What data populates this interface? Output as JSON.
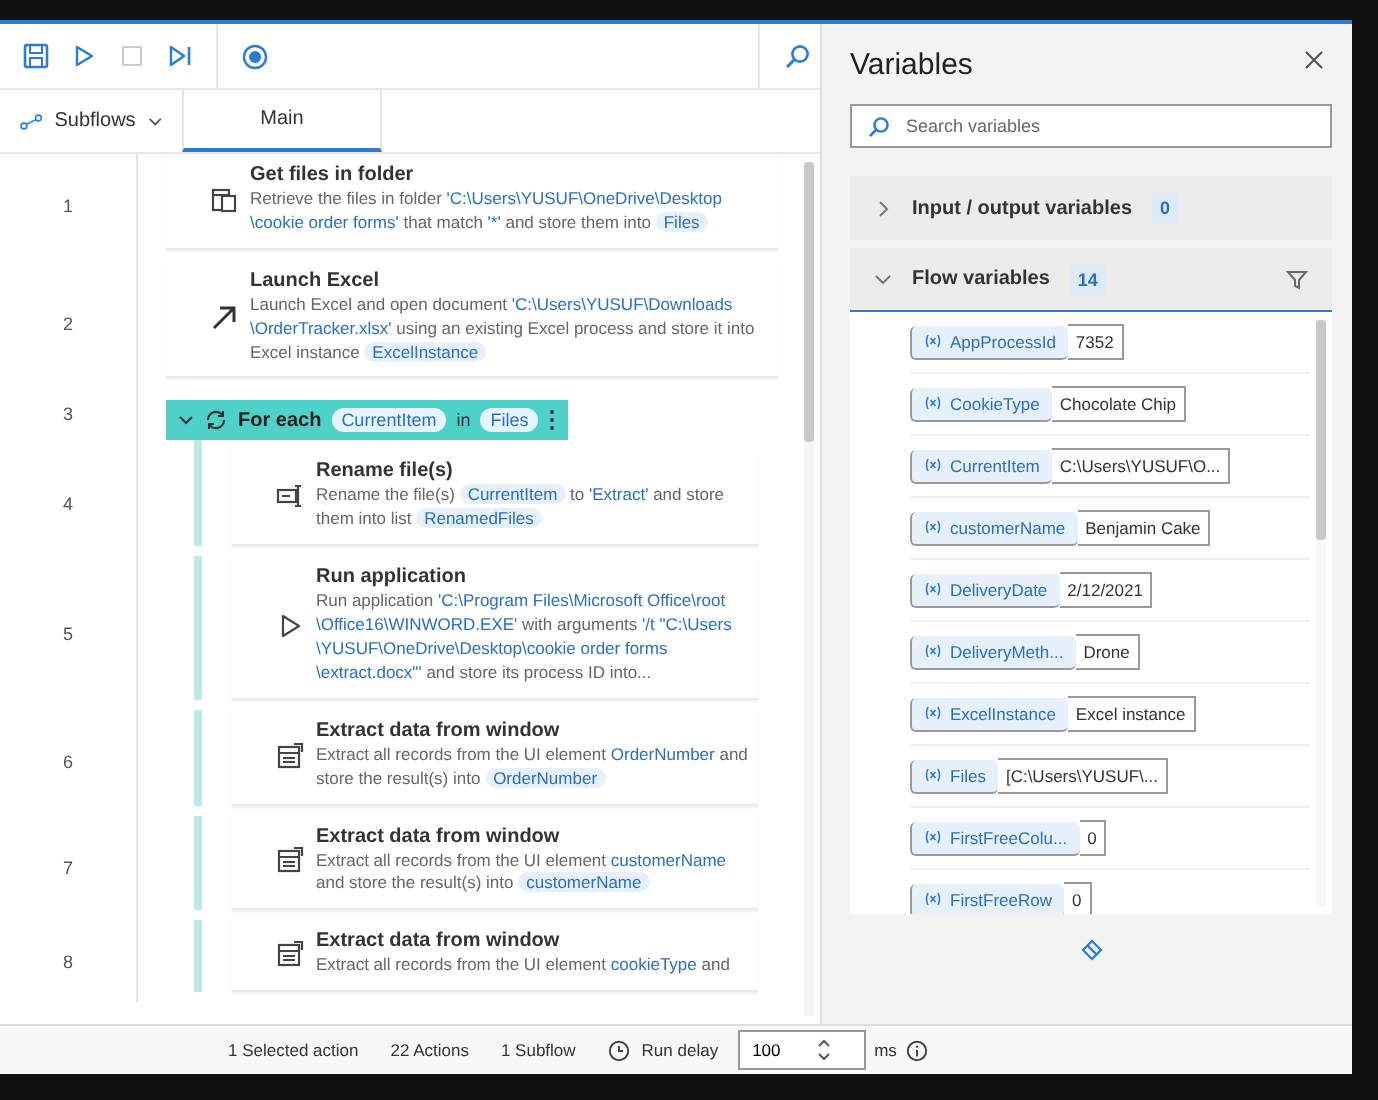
{
  "subflows_button": {
    "label": "Subflows"
  },
  "tabs": [
    {
      "label": "Main",
      "selected": true
    }
  ],
  "actions": [
    {
      "number": "1",
      "kind": "files",
      "selected": false,
      "title": "Get files in folder",
      "description": [
        {
          "kind": "text",
          "text": "Retrieve the files in folder "
        },
        {
          "kind": "literal",
          "text": "'C:\\Users\\YUSUF\\OneDrive\\Desktop \\cookie order forms'"
        },
        {
          "kind": "text",
          "text": " that match "
        },
        {
          "kind": "literal",
          "text": "'*'"
        },
        {
          "kind": "text",
          "text": " and store them into "
        },
        {
          "kind": "variable",
          "text": "Files"
        }
      ]
    },
    {
      "number": "2",
      "kind": "launch",
      "selected": false,
      "title": "Launch Excel",
      "description": [
        {
          "kind": "text",
          "text": "Launch Excel and open document "
        },
        {
          "kind": "literal",
          "text": "'C:\\Users\\YUSUF\\Downloads \\OrderTracker.xlsx'"
        },
        {
          "kind": "text",
          "text": " using an existing Excel process and store it into Excel instance "
        },
        {
          "kind": "variable",
          "text": "ExcelInstance"
        }
      ]
    },
    {
      "number": "3",
      "kind": "loop",
      "selected": true,
      "expanded": true,
      "header": [
        {
          "kind": "text",
          "text": "For each"
        },
        {
          "kind": "variable",
          "text": "CurrentItem"
        },
        {
          "kind": "text",
          "text": "in"
        },
        {
          "kind": "variable",
          "text": "Files"
        }
      ],
      "children": [
        {
          "number": "4",
          "kind": "rename",
          "selected": false,
          "title": "Rename file(s)",
          "description": [
            {
              "kind": "text",
              "text": "Rename the file(s) "
            },
            {
              "kind": "variable",
              "text": "CurrentItem"
            },
            {
              "kind": "text",
              "text": " to "
            },
            {
              "kind": "literal",
              "text": "'Extract'"
            },
            {
              "kind": "text",
              "text": " and store them into list "
            },
            {
              "kind": "variable",
              "text": "RenamedFiles"
            }
          ]
        },
        {
          "number": "5",
          "kind": "run",
          "selected": false,
          "title": "Run application",
          "description": [
            {
              "kind": "text",
              "text": "Run application "
            },
            {
              "kind": "literal",
              "text": "'C:\\Program Files\\Microsoft Office\\root \\Office16\\WINWORD.EXE'"
            },
            {
              "kind": "text",
              "text": " with arguments "
            },
            {
              "kind": "literal",
              "text": "'/t \"C:\\Users \\YUSUF\\OneDrive\\Desktop\\cookie order forms \\extract.docx\"'"
            },
            {
              "kind": "text",
              "text": " and store its process ID into..."
            }
          ]
        },
        {
          "number": "6",
          "kind": "extract",
          "selected": false,
          "title": "Extract data from window",
          "description": [
            {
              "kind": "text",
              "text": "Extract all records from the UI element "
            },
            {
              "kind": "literal",
              "text": "OrderNumber"
            },
            {
              "kind": "text",
              "text": " and store the result(s) into "
            },
            {
              "kind": "variable",
              "text": "OrderNumber"
            }
          ]
        },
        {
          "number": "7",
          "kind": "extract",
          "selected": false,
          "title": "Extract data from window",
          "description": [
            {
              "kind": "text",
              "text": "Extract all records from the UI element "
            },
            {
              "kind": "literal",
              "text": "customerName"
            },
            {
              "kind": "text",
              "text": " and store the result(s) into "
            },
            {
              "kind": "variable",
              "text": "customerName"
            }
          ]
        },
        {
          "number": "8",
          "kind": "extract",
          "selected": false,
          "title": "Extract data from window",
          "description": [
            {
              "kind": "text",
              "text": "Extract all records from the UI element "
            },
            {
              "kind": "literal",
              "text": "cookieType"
            },
            {
              "kind": "text",
              "text": " and"
            }
          ]
        }
      ]
    }
  ],
  "variables_panel": {
    "title": "Variables",
    "search": {
      "placeholder": "Search variables"
    },
    "sections": [
      {
        "title": "Input / output variables",
        "count": "0",
        "expanded": false
      },
      {
        "title": "Flow variables",
        "count": "14",
        "expanded": true,
        "variables": [
          {
            "name": "AppProcessId",
            "value": "7352"
          },
          {
            "name": "CookieType",
            "value": "Chocolate Chip"
          },
          {
            "name": "CurrentItem",
            "value": "C:\\Users\\YUSUF\\O..."
          },
          {
            "name": "customerName",
            "value": "Benjamin Cake"
          },
          {
            "name": "DeliveryDate",
            "value": "2/12/2021"
          },
          {
            "name": "DeliveryMeth...",
            "value": "Drone"
          },
          {
            "name": "ExcelInstance",
            "value": "Excel instance"
          },
          {
            "name": "Files",
            "value": "[C:\\Users\\YUSUF\\..."
          },
          {
            "name": "FirstFreeColu...",
            "value": "0"
          },
          {
            "name": "FirstFreeRow",
            "value": "0"
          }
        ]
      }
    ]
  },
  "status_bar": {
    "selected": "1 Selected action",
    "actions": "22 Actions",
    "subflows": "1 Subflow",
    "run_delay_label": "Run delay",
    "run_delay_value": "100",
    "unit": "ms"
  }
}
